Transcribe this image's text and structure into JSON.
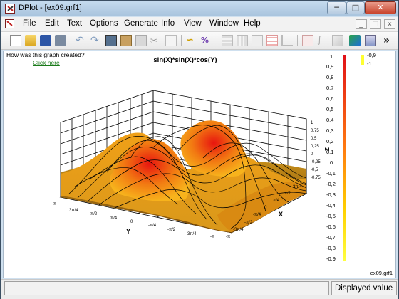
{
  "window": {
    "title": "DPlot - [ex09.grf1]",
    "minimize_glyph": "─",
    "maximize_glyph": "□",
    "close_glyph": "✕"
  },
  "menu": {
    "items": [
      "File",
      "Edit",
      "Text",
      "Options",
      "Generate",
      "Info",
      "View",
      "Window",
      "Help"
    ],
    "mdi_min_glyph": "_",
    "mdi_restore_glyph": "❐",
    "mdi_close_glyph": "×"
  },
  "toolbar": {
    "icons": [
      "new-document-icon",
      "open-folder-icon",
      "save-disk-icon",
      "print-icon",
      "undo-icon",
      "redo-icon",
      "print-preview-icon",
      "paste-icon",
      "clipboard-icon",
      "scissors-icon",
      "copy-icon",
      "curve-icon",
      "percent-curve-icon",
      "grid-icon",
      "grid-alt-icon",
      "table-icon",
      "legend-icon",
      "axis-icon",
      "zoom-icon",
      "integral-icon",
      "line-icon",
      "bar-icon",
      "color-map-icon",
      "surface-icon"
    ],
    "overflow_glyph": "»"
  },
  "plot": {
    "help_text": "How was this graph created?",
    "link_text": "Click here",
    "title": "sin(X)*sin(X)*cos(Y)",
    "filename": "ex09.grf1",
    "z_axis_label": "Z",
    "z_ticks": [
      "1",
      "0,75",
      "0,5",
      "0,25",
      "0",
      "-0,25",
      "-0,5",
      "-0,75"
    ],
    "y_axis_label": "Y",
    "y_ticks": [
      "π",
      "3π/4",
      "π/2",
      "π/4",
      "0",
      "-π/4",
      "-π/2",
      "-3π/4",
      "-π"
    ],
    "x_axis_label": "X",
    "x_ticks": [
      "-π",
      "-3π/4",
      "-π/2",
      "-π/4",
      "0",
      "π/4",
      "π/2",
      "3π/4"
    ],
    "legend_top_left": "1",
    "legend_top_right_a": "-0,9",
    "legend_top_right_b": "-1",
    "legend_ticks": [
      "0,9",
      "0,8",
      "0,7",
      "0,6",
      "0,5",
      "0,4",
      "0,3",
      "0,2",
      "0,1",
      "0",
      "-0,1",
      "-0,2",
      "-0,3",
      "-0,4",
      "-0,5",
      "-0,6",
      "-0,7",
      "-0,8",
      "-0,9"
    ]
  },
  "status": {
    "left": "",
    "right": "Displayed value"
  }
}
